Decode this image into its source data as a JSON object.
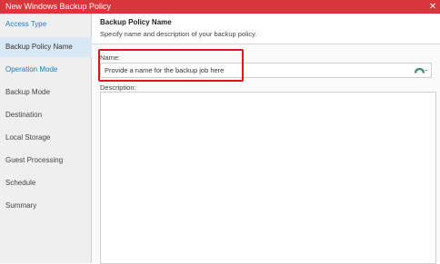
{
  "window": {
    "title": "New Windows Backup Policy",
    "close_glyph": "✕"
  },
  "sidebar": {
    "items": [
      {
        "label": "Access Type",
        "state": "done"
      },
      {
        "label": "Backup Policy Name",
        "state": "active"
      },
      {
        "label": "Operation Mode",
        "state": "done"
      },
      {
        "label": "Backup Mode",
        "state": "pending"
      },
      {
        "label": "Destination",
        "state": "pending"
      },
      {
        "label": "Local Storage",
        "state": "pending"
      },
      {
        "label": "Guest Processing",
        "state": "pending"
      },
      {
        "label": "Schedule",
        "state": "pending"
      },
      {
        "label": "Summary",
        "state": "pending"
      }
    ]
  },
  "header": {
    "title": "Backup Policy Name",
    "subtitle": "Specify name and description of your backup policy."
  },
  "form": {
    "name_label": "Name:",
    "name_value": "",
    "name_placeholder": "Provide a name for the backup job here",
    "name_icon": "password-manager-icon",
    "description_label": "Description:",
    "description_value": ""
  },
  "colors": {
    "titlebar": "#d9353a",
    "link": "#1a7fc4",
    "active_item": "#d8e8f5",
    "highlight": "#e0141b"
  }
}
